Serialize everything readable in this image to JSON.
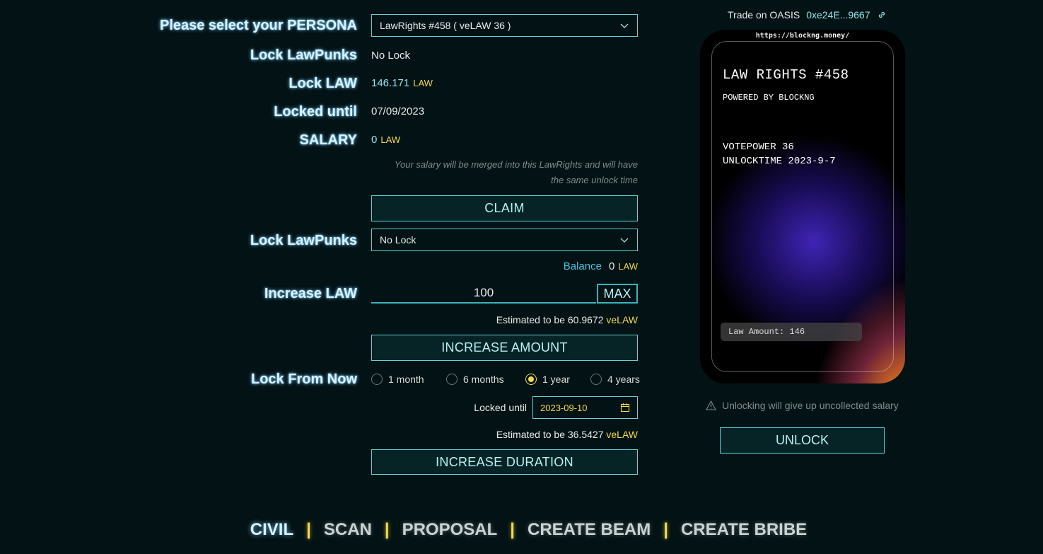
{
  "form": {
    "persona_label": "Please select your PERSONA",
    "persona_value": "LawRights #458 ( veLAW 36 )",
    "lock_lawpunks_label": "Lock LawPunks",
    "lock_lawpunks_value": "No Lock",
    "lock_law_label": "Lock LAW",
    "lock_law_value": "146.171",
    "lock_law_unit": "LAW",
    "locked_until_label": "Locked until",
    "locked_until_value": "07/09/2023",
    "salary_label": "SALARY",
    "salary_value": "0",
    "salary_unit": "LAW",
    "salary_note_1": "Your salary will be merged into this LawRights and will have",
    "salary_note_2": "the same unlock time",
    "claim_button": "CLAIM",
    "lock_lawpunks_select_label": "Lock LawPunks",
    "lock_lawpunks_select_value": "No Lock",
    "balance_label": "Balance",
    "balance_value": "0",
    "balance_unit": "LAW",
    "increase_law_label": "Increase LAW",
    "increase_law_value": "100",
    "max_button": "MAX",
    "estimate_amount_text": "Estimated to be 60.9672",
    "estimate_amount_unit": "veLAW",
    "increase_amount_button": "INCREASE AMOUNT",
    "lock_from_now_label": "Lock From Now",
    "durations": [
      "1 month",
      "6 months",
      "1 year",
      "4 years"
    ],
    "selected_duration": "1 year",
    "new_locked_until_label": "Locked until",
    "new_locked_until_value": "2023-09-10",
    "estimate_duration_text": "Estimated to be 36.5427",
    "estimate_duration_unit": "veLAW",
    "increase_duration_button": "INCREASE DURATION"
  },
  "trade": {
    "label": "Trade on OASIS",
    "address": "0xe24E...9667"
  },
  "nft_card": {
    "url": "https://blockng.money/",
    "title": "LAW RIGHTS #458",
    "powered_by": "POWERED BY BLOCKNG",
    "votepower": "VOTEPOWER 36",
    "unlocktime": "UNLOCKTIME 2023-9-7",
    "amount": "Law Amount: 146"
  },
  "unlock": {
    "warning": "Unlocking will give up uncollected salary",
    "button": "UNLOCK"
  },
  "nav": {
    "items": [
      "CIVIL",
      "SCAN",
      "PROPOSAL",
      "CREATE BEAM",
      "CREATE BRIBE"
    ],
    "separator": "|"
  },
  "colors": {
    "background": "#031214",
    "accent": "#5fd4dc",
    "highlight": "#f2d94e",
    "label_glow": "#d6f3ff"
  }
}
